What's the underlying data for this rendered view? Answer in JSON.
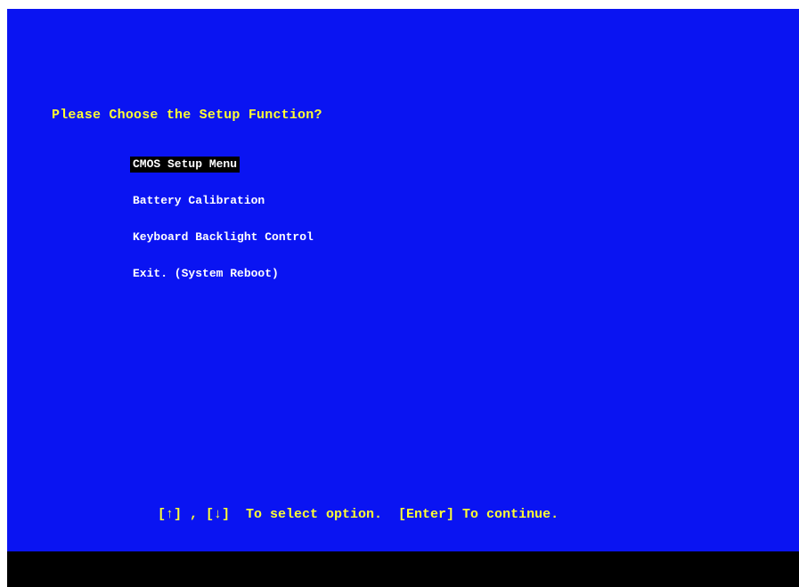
{
  "screen": {
    "title": "Please Choose the Setup Function?",
    "menu": {
      "selected_index": 0,
      "items": [
        {
          "label": "CMOS Setup Menu"
        },
        {
          "label": "Battery Calibration"
        },
        {
          "label": "Keyboard Backlight Control"
        },
        {
          "label": "Exit. (System Reboot)"
        }
      ]
    },
    "hint": "[↑] , [↓]  To select option.  [Enter] To continue."
  },
  "colors": {
    "background": "#0a14f2",
    "title": "#ffff33",
    "menu_text": "#ffffff",
    "selection_bg": "#000000",
    "footer_bar": "#000000"
  }
}
